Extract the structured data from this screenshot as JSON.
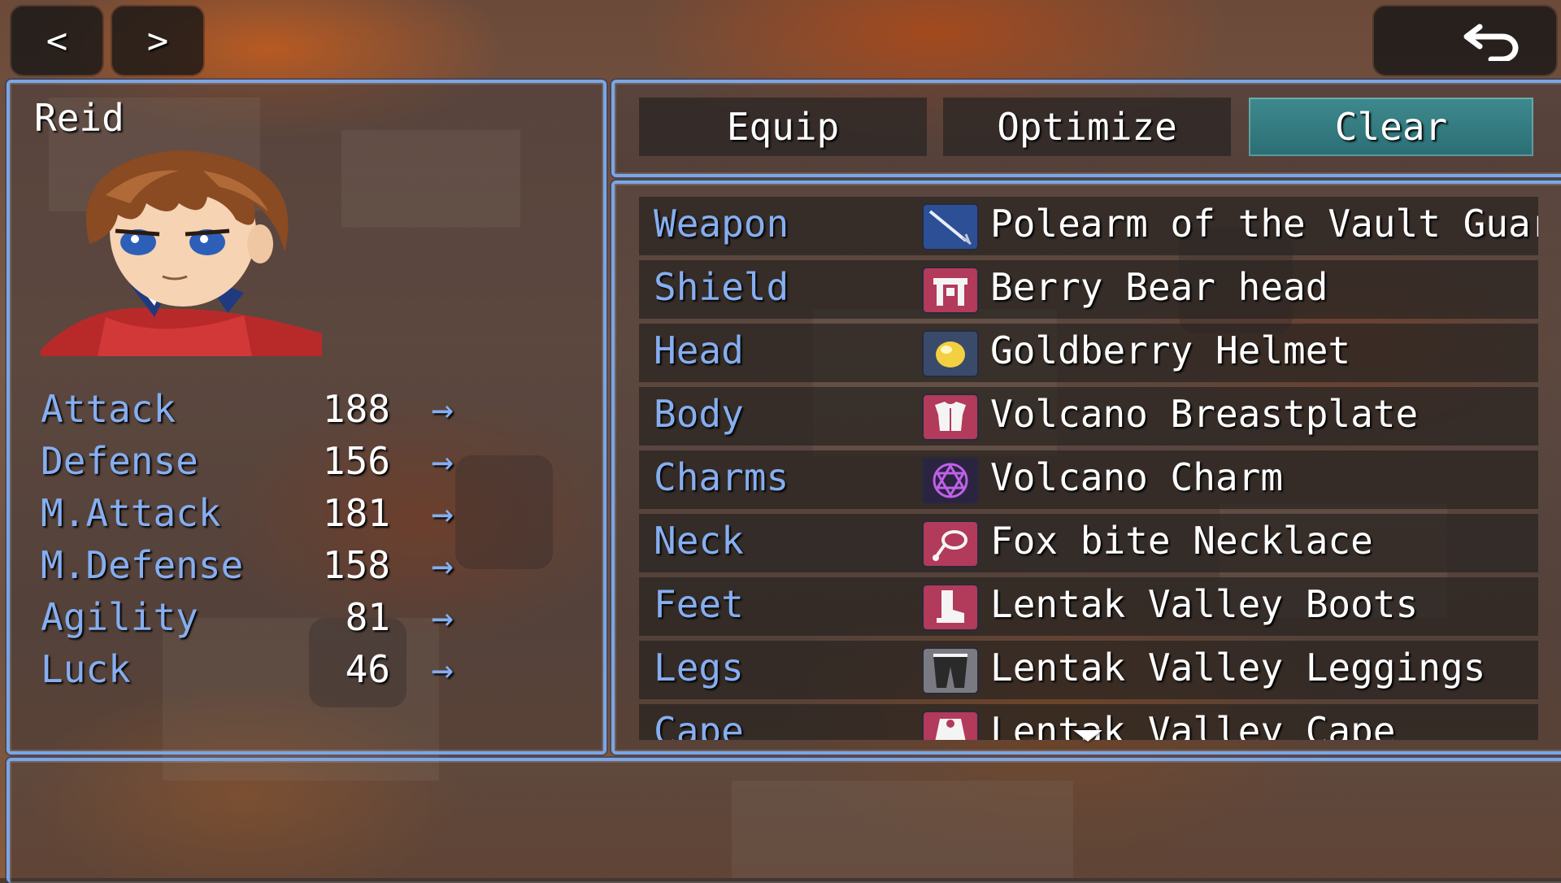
{
  "nav": {
    "prev_label": "<",
    "next_label": ">",
    "back_icon": "undo-arrow-icon"
  },
  "actor": {
    "name": "Reid",
    "portrait_icon": "hero-face-portrait"
  },
  "params": [
    {
      "label": "Attack",
      "value": "188",
      "arrow": "→"
    },
    {
      "label": "Defense",
      "value": "156",
      "arrow": "→"
    },
    {
      "label": "M.Attack",
      "value": "181",
      "arrow": "→"
    },
    {
      "label": "M.Defense",
      "value": "158",
      "arrow": "→"
    },
    {
      "label": "Agility",
      "value": "81",
      "arrow": "→"
    },
    {
      "label": "Luck",
      "value": "46",
      "arrow": "→"
    }
  ],
  "commands": [
    {
      "label": "Equip"
    },
    {
      "label": "Optimize"
    },
    {
      "label": "Clear"
    }
  ],
  "slots": [
    {
      "label": "Weapon",
      "item": "Polearm of the Vault Guardian",
      "icon": "polearm-icon"
    },
    {
      "label": "Shield",
      "item": "Berry Bear head",
      "icon": "bear-head-icon"
    },
    {
      "label": "Head",
      "item": "Goldberry Helmet",
      "icon": "gold-orb-icon"
    },
    {
      "label": "Body",
      "item": "Volcano Breastplate",
      "icon": "breastplate-icon"
    },
    {
      "label": "Charms",
      "item": "Volcano Charm",
      "icon": "hexagram-icon"
    },
    {
      "label": "Neck",
      "item": "Fox bite Necklace",
      "icon": "necklace-icon"
    },
    {
      "label": "Feet",
      "item": "Lentak Valley Boots",
      "icon": "boot-icon"
    },
    {
      "label": "Legs",
      "item": "Lentak Valley Leggings",
      "icon": "leggings-icon"
    },
    {
      "label": "Cape",
      "item": "Lentak Valley Cape",
      "icon": "cape-icon"
    }
  ],
  "colors": {
    "window_border": "#7aa6e6",
    "system_text": "#86aef0",
    "active_command": "#3e8a8e"
  }
}
